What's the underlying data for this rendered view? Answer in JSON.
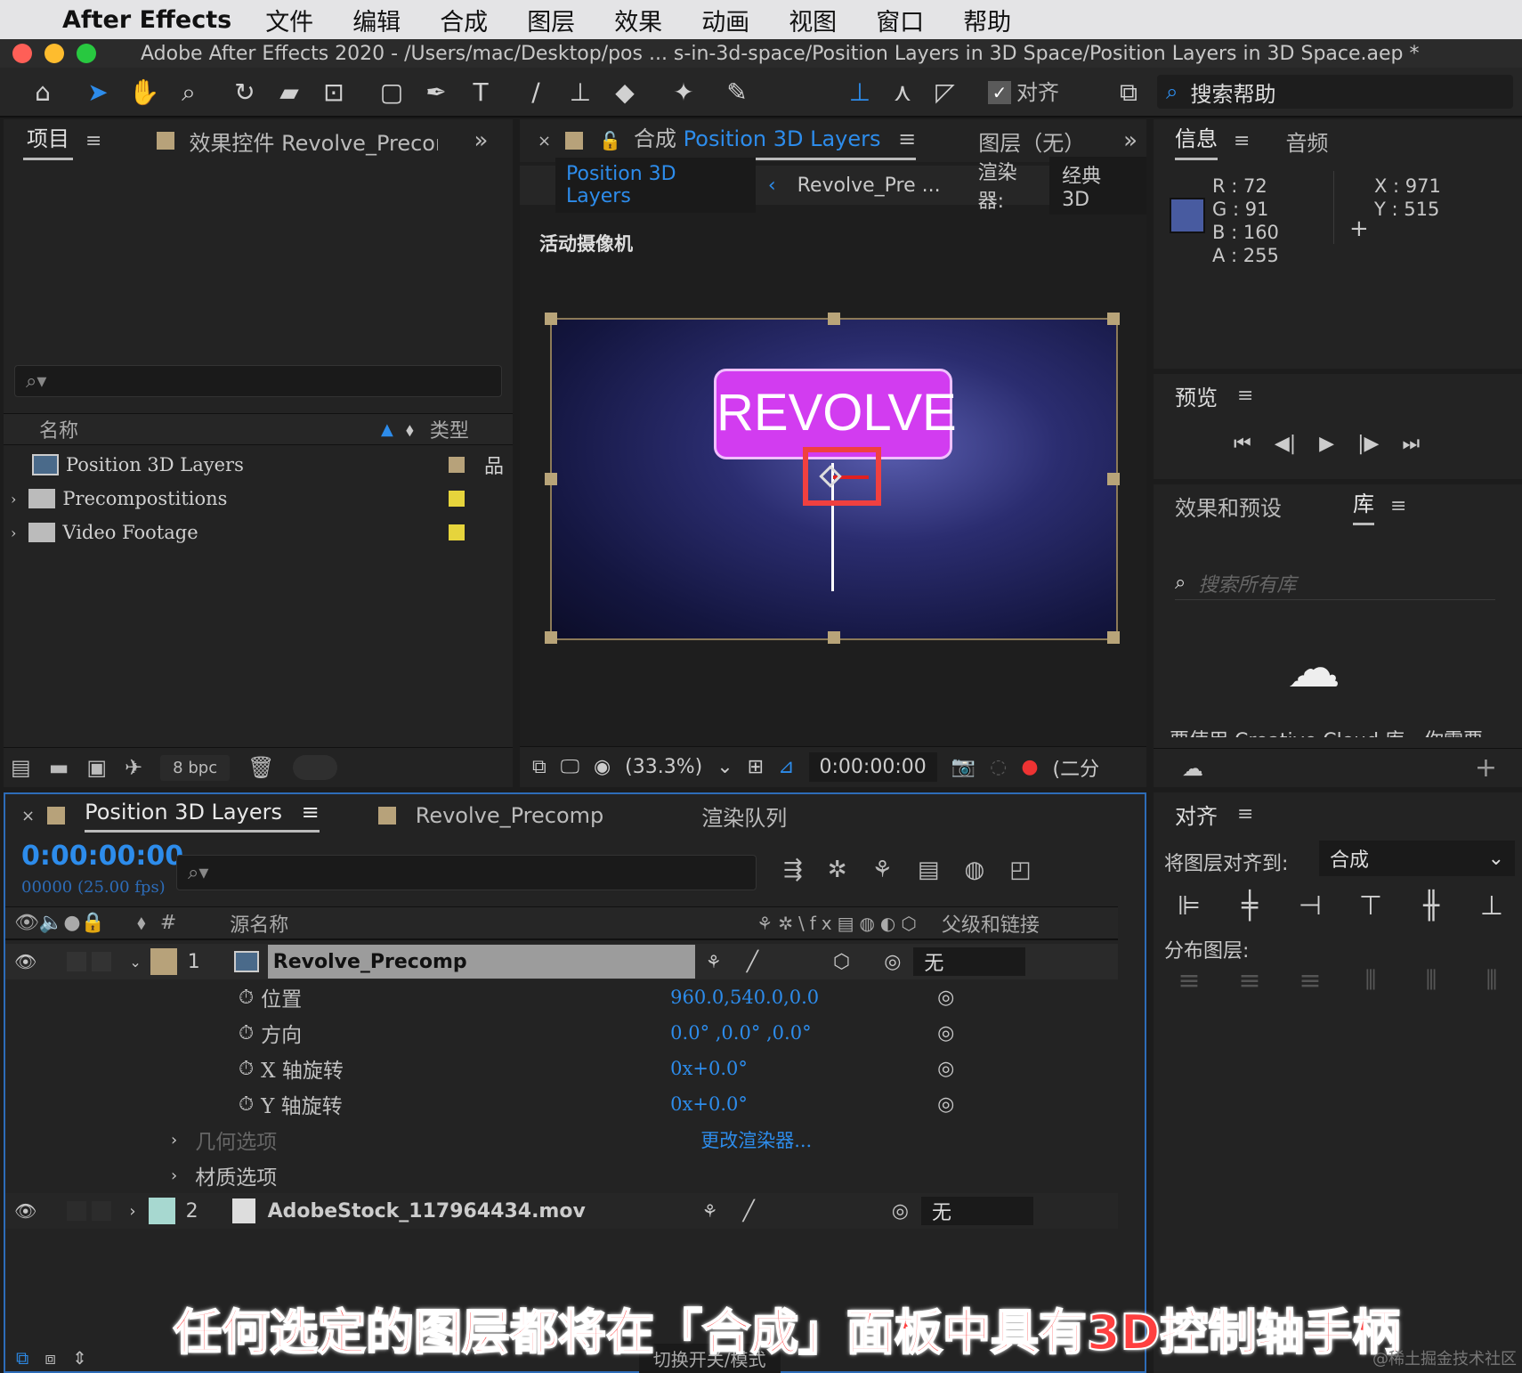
{
  "menubar": {
    "app": "After Effects",
    "items": [
      "文件",
      "编辑",
      "合成",
      "图层",
      "效果",
      "动画",
      "视图",
      "窗口",
      "帮助"
    ]
  },
  "title": "Adobe After Effects 2020 - /Users/mac/Desktop/pos ... s-in-3d-space/Position Layers in 3D Space/Position Layers in 3D Space.aep *",
  "toolbar": {
    "align_label": "对齐",
    "search_help": "搜索帮助"
  },
  "project_panel": {
    "tab": "项目",
    "effects_tab": "效果控件 Revolve_Precomp",
    "col_name": "名称",
    "col_type": "类型",
    "items": [
      {
        "name": "Position 3D Layers",
        "color": "#b7a27a"
      },
      {
        "name": "Precompostitions",
        "color": "#e6d43c"
      },
      {
        "name": "Video Footage",
        "color": "#e6d43c"
      }
    ],
    "bpc": "8 bpc"
  },
  "comp_panel": {
    "tab_prefix": "合成",
    "tab_name": "Position 3D Layers",
    "layer_tab": "图层（无）",
    "breadcrumb1": "Position 3D Layers",
    "breadcrumb2": "Revolve_Pre ...",
    "renderer_label": "渲染器:",
    "renderer_value": "经典 3D",
    "camera_label": "活动摄像机",
    "revolve_text": "REVOLVE",
    "zoom": "(33.3%)",
    "timecode": "0:00:00:00",
    "resolution": "(二分"
  },
  "info_panel": {
    "tab": "信息",
    "audio_tab": "音频",
    "r": "R :  72",
    "g": "G :  91",
    "b": "B :  160",
    "a": "A :  255",
    "x": "X : 971",
    "y": "Y :  515",
    "swatch_color": "#485ba0"
  },
  "preview_panel": {
    "tab": "预览"
  },
  "effects_panel": {
    "tab": "效果和预设",
    "lib_tab": "库",
    "search_placeholder": "搜索所有库",
    "cut_text": "要使用 Creative Cloud 库，你需要"
  },
  "align_panel": {
    "tab": "对齐",
    "align_to_label": "将图层对齐到:",
    "align_to_value": "合成",
    "distribute_label": "分布图层:"
  },
  "timeline": {
    "tab": "Position 3D Layers",
    "tab2": "Revolve_Precomp",
    "tab3": "渲染队列",
    "timecode": "0:00:00:00",
    "frames": "00000 (25.00 fps)",
    "col_hash": "#",
    "col_source": "源名称",
    "col_parent": "父级和链接",
    "layers": [
      {
        "num": "1",
        "name": "Revolve_Precomp",
        "parent": "无",
        "color": "#b7a27a"
      },
      {
        "num": "2",
        "name": "AdobeStock_117964434.mov",
        "parent": "无",
        "color": "#a7d8d0"
      }
    ],
    "props": [
      {
        "label": "位置",
        "value": "960.0,540.0,0.0"
      },
      {
        "label": "方向",
        "value": "0.0° ,0.0° ,0.0°"
      },
      {
        "label": "X 轴旋转",
        "value": "0x+0.0°"
      },
      {
        "label": "Y 轴旋转",
        "value": "0x+0.0°"
      }
    ],
    "geometry": "几何选项",
    "geometry_value": "更改渲染器...",
    "material": "材质选项",
    "toggle_modes": "切换开关/模式"
  },
  "caption": "任何选定的图层都将在「合成」面板中具有3D控制轴手柄",
  "watermark": "@稀土掘金技术社区"
}
